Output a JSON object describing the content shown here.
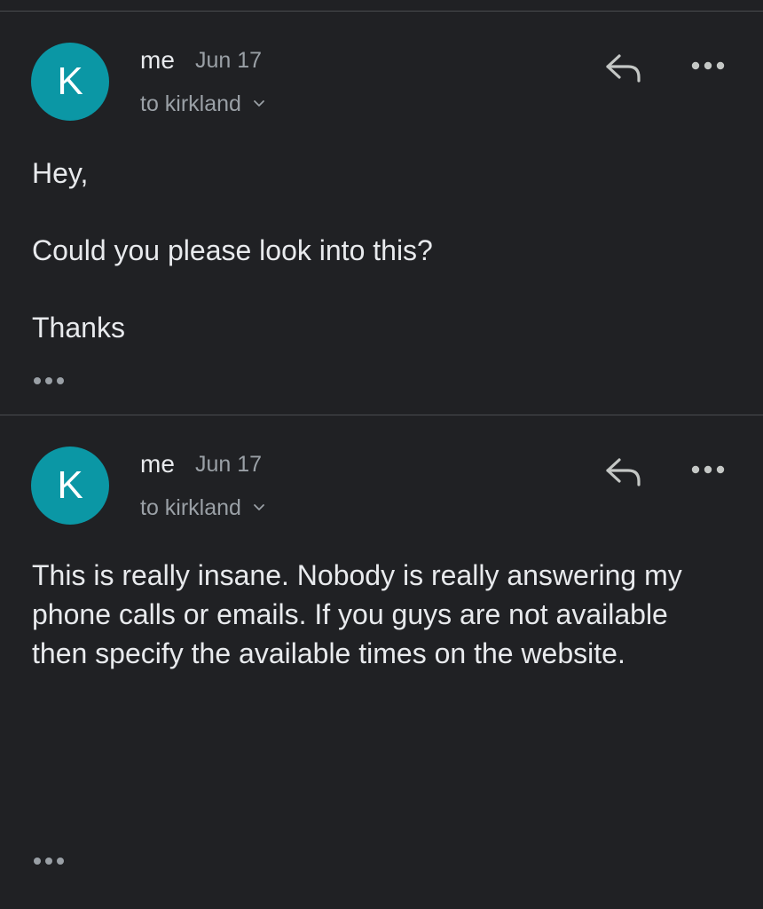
{
  "messages": [
    {
      "avatar_letter": "K",
      "sender": "me",
      "date": "Jun 17",
      "recipient": "to kirkland",
      "body": [
        "Hey,",
        "Could you please look into this?",
        "Thanks"
      ]
    },
    {
      "avatar_letter": "K",
      "sender": "me",
      "date": "Jun 17",
      "recipient": "to kirkland",
      "body": [
        "This is really insane. Nobody is really answering my phone calls or emails. If you guys are not available then specify the available times on the website."
      ]
    }
  ],
  "icons": {
    "reply": "reply-arrow-icon",
    "more": "more-horizontal-icon",
    "expand": "chevron-down-icon",
    "trimmed_content": "ellipsis-icon"
  },
  "colors": {
    "background": "#202124",
    "avatar": "#0b97a5",
    "divider": "#4a4c50",
    "primary_text": "#e8eaed",
    "secondary_text": "#9aa0a6"
  }
}
